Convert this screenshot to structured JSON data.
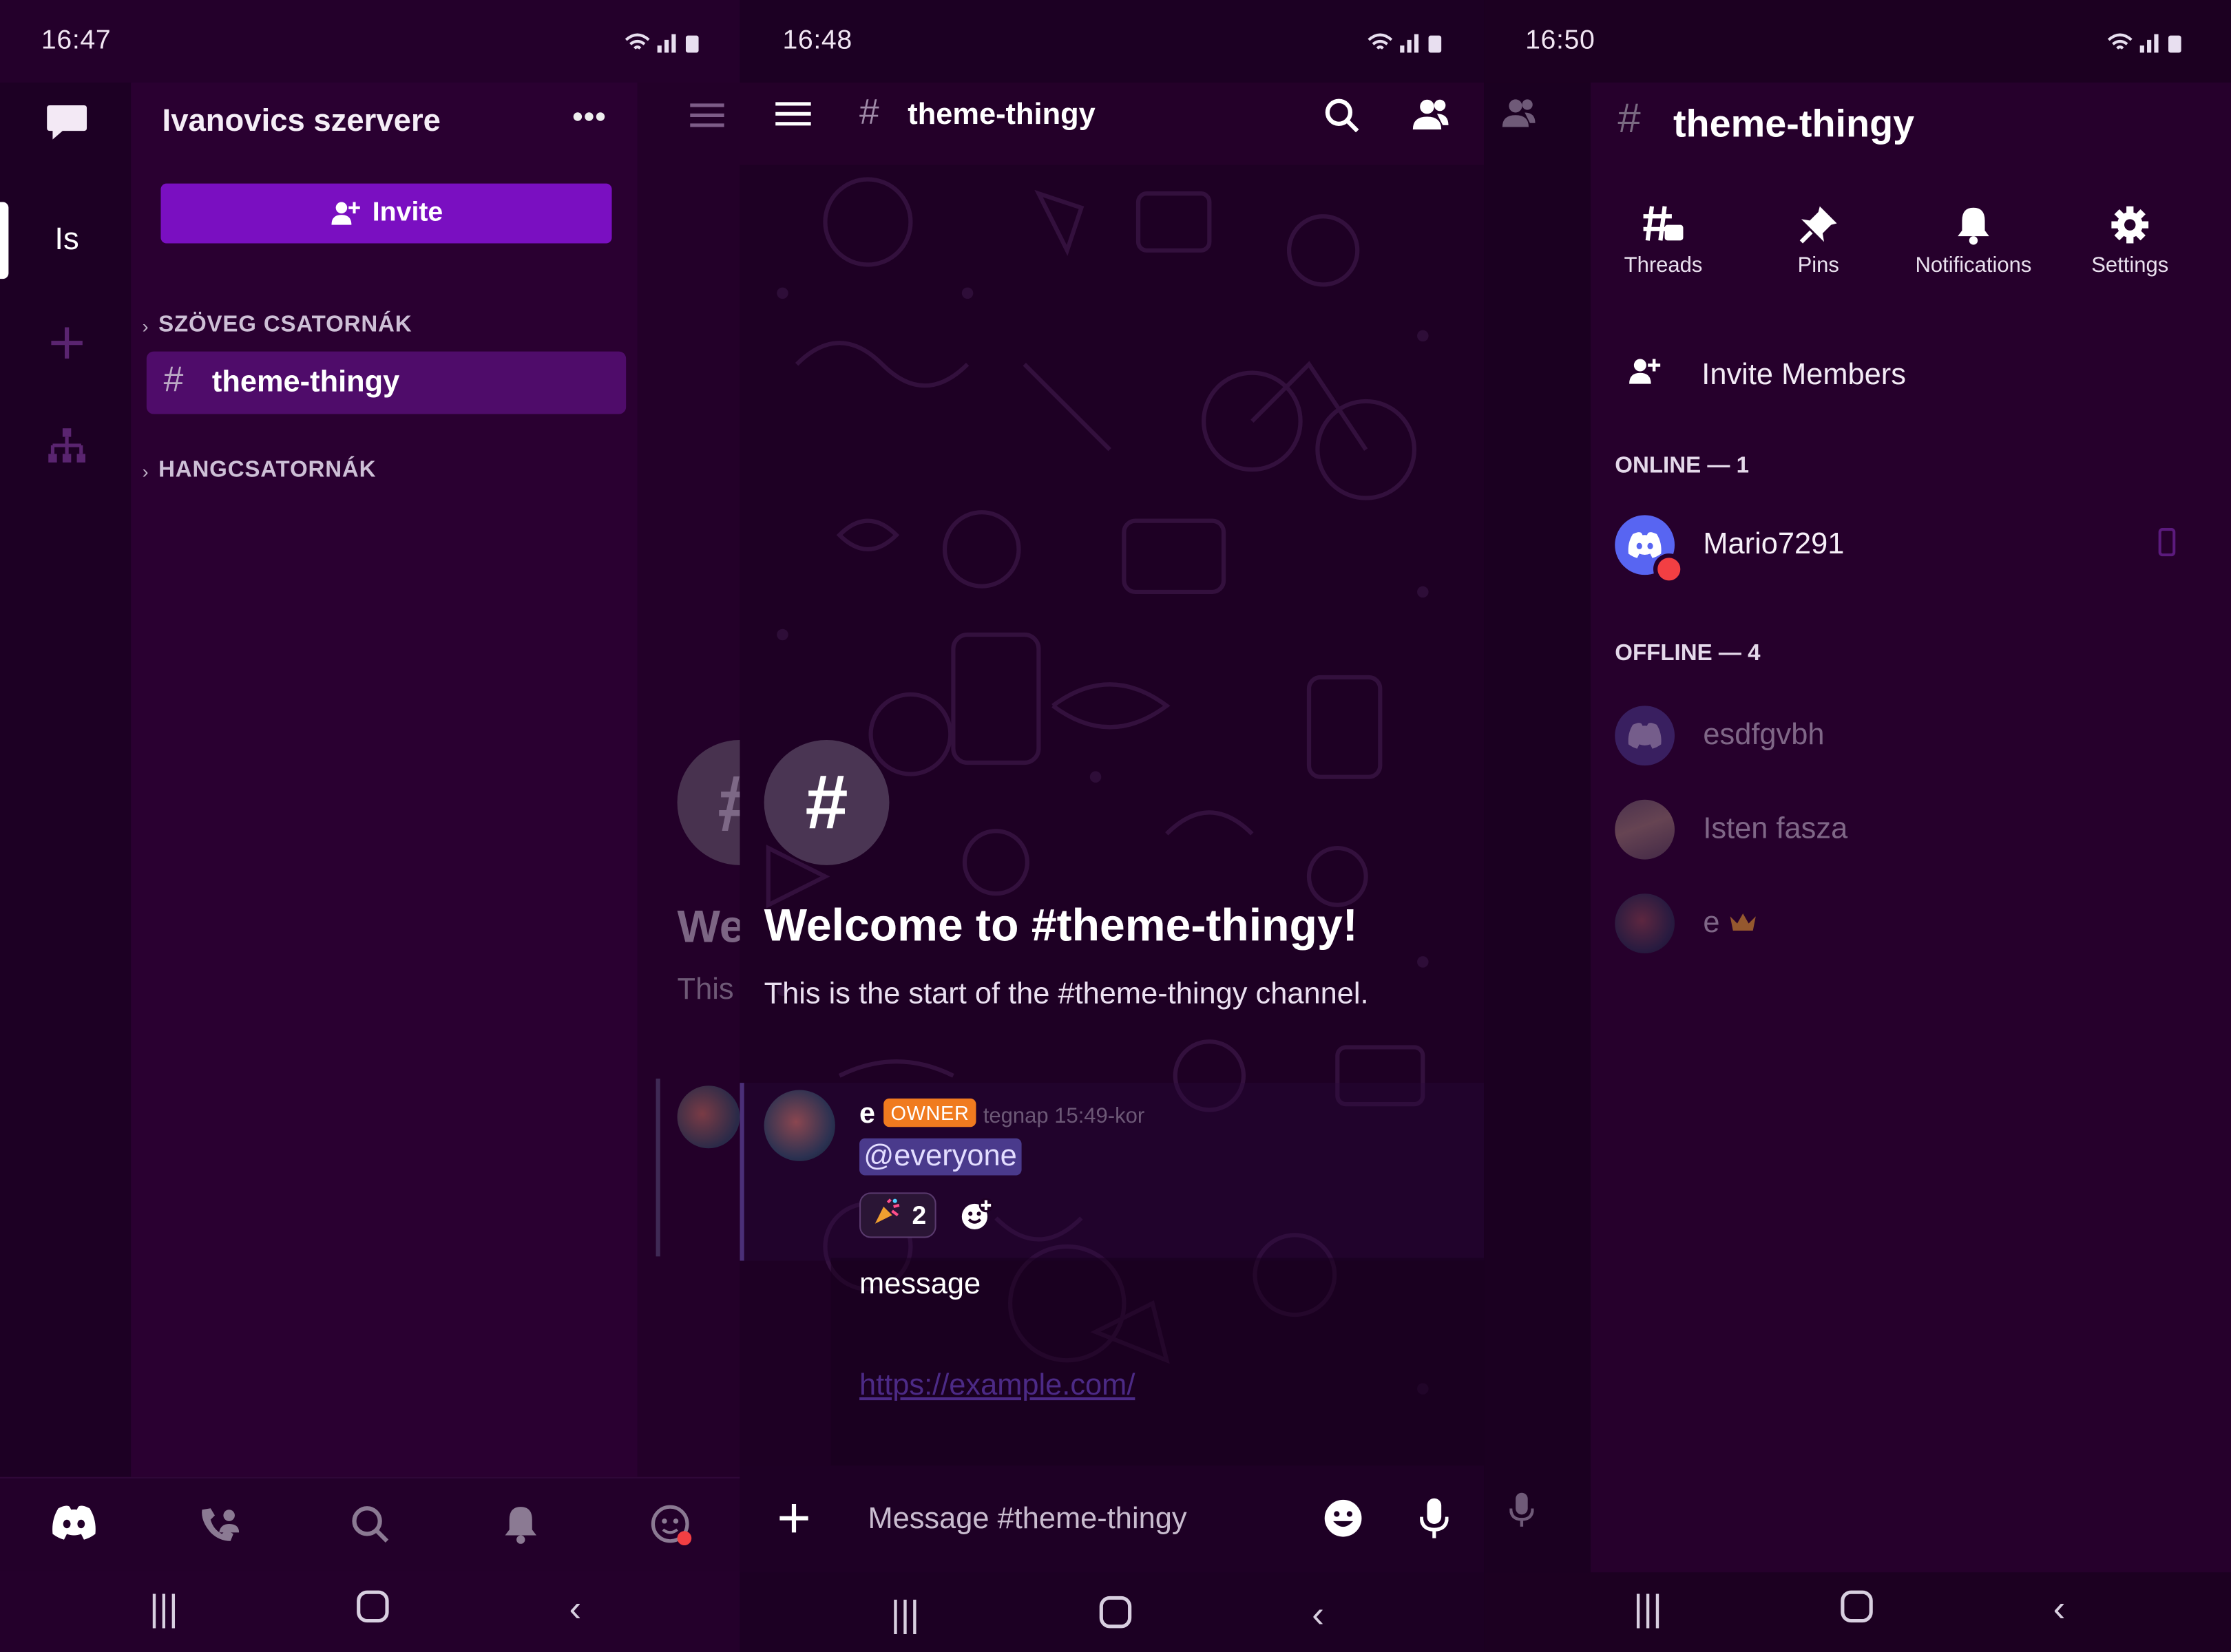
{
  "colors": {
    "accent": "#7a0fc1",
    "selected": "#4f0c6a",
    "owner_badge": "#f07b1f",
    "mention_bg": "#4a3a8c",
    "brand_avatar": "#5865f2",
    "dnd": "#f23f43"
  },
  "screen1": {
    "status": {
      "time": "16:47"
    },
    "rail": {
      "dm_icon": "chat-bubble-icon",
      "server_initials": "Is",
      "add_icon": "plus-icon",
      "hub_icon": "hierarchy-icon"
    },
    "server_name": "Ivanovics szervere",
    "more_icon": "ellipsis-icon",
    "invite_label": "Invite",
    "text_category": "SZÖVEG CSATORNÁK",
    "channel": "theme-thingy",
    "voice_category": "HANGCSATORNÁK",
    "peek": {
      "hash": "#",
      "welcome": "We",
      "start": "This"
    },
    "bottom_icons": [
      "discord-icon",
      "friends-icon",
      "search-icon",
      "bell-icon",
      "profile-icon"
    ]
  },
  "screen2": {
    "status": {
      "time": "16:48"
    },
    "channel": "theme-thingy",
    "welcome_title": "Welcome to #theme-thingy!",
    "welcome_sub": "This is the start of the #theme-thingy channel.",
    "message": {
      "author": "e",
      "badge": "OWNER",
      "timestamp": "tegnap 15:49-kor",
      "mention": "@everyone",
      "reaction_count": "2",
      "text": "message",
      "link": "https://example.com/"
    },
    "composer_placeholder": "Message #theme-thingy"
  },
  "screen3": {
    "status": {
      "time": "16:50"
    },
    "channel": "theme-thingy",
    "tools": [
      {
        "label": "Threads"
      },
      {
        "label": "Pins"
      },
      {
        "label": "Notifications"
      },
      {
        "label": "Settings"
      }
    ],
    "invite_members": "Invite Members",
    "online_header": "ONLINE — 1",
    "online": [
      {
        "name": "Mario7291"
      }
    ],
    "offline_header": "OFFLINE — 4",
    "offline": [
      {
        "name": "esdfgvbh"
      },
      {
        "name": "Isten fasza"
      },
      {
        "name": "e"
      }
    ]
  }
}
